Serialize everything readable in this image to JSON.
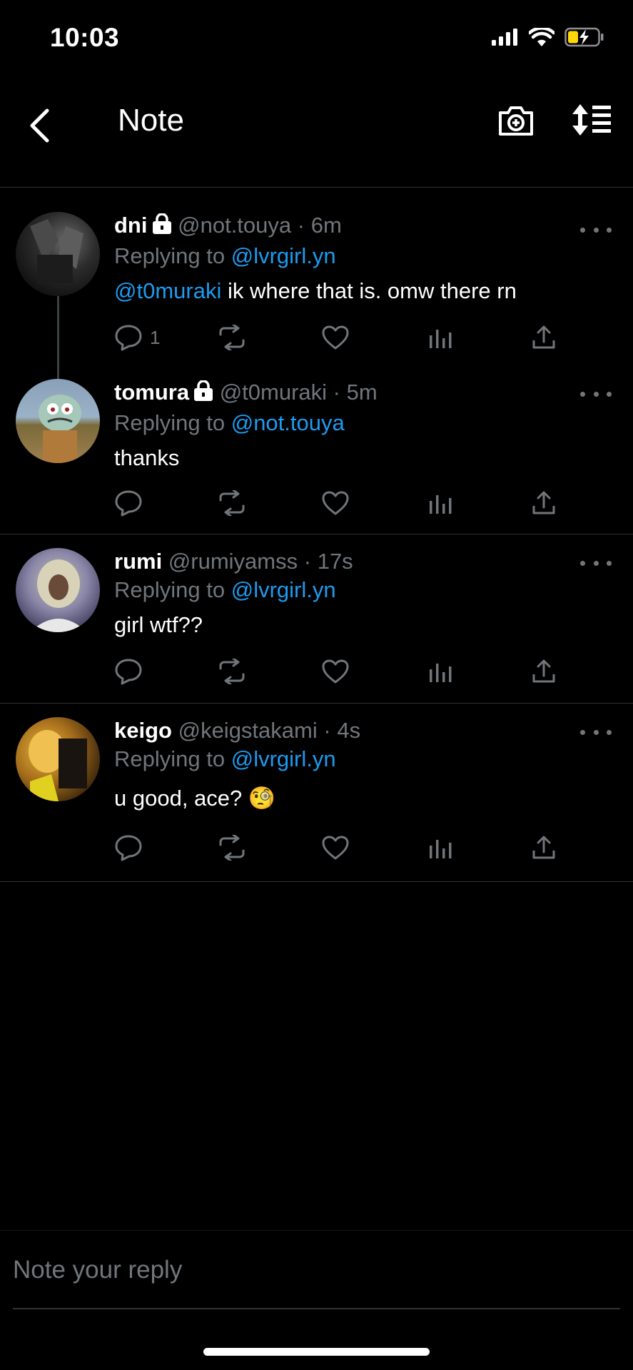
{
  "status_bar": {
    "time": "10:03"
  },
  "header": {
    "title": "Note"
  },
  "replies": [
    {
      "name": "dni",
      "handle": "@not.touya",
      "dot": "·",
      "time": "6m",
      "replying_prefix": "Replying to",
      "replying_to": "@lvrgirl.yn",
      "mention": "@t0muraki",
      "text": " ik where that is. omw there rn",
      "reply_count": "1",
      "locked": true
    },
    {
      "name": "tomura",
      "handle": "@t0muraki",
      "dot": "·",
      "time": "5m",
      "replying_prefix": "Replying to",
      "replying_to": "@not.touya",
      "text": "thanks",
      "reply_count": "",
      "locked": true
    },
    {
      "name": "rumi",
      "handle": "@rumiyamss",
      "dot": "·",
      "time": "17s",
      "replying_prefix": "Replying to",
      "replying_to": "@lvrgirl.yn",
      "text": "girl wtf??",
      "reply_count": "",
      "locked": false
    },
    {
      "name": "keigo",
      "handle": "@keigstakami",
      "dot": "·",
      "time": "4s",
      "replying_prefix": "Replying to",
      "replying_to": "@lvrgirl.yn",
      "text": "u good, ace? 🧐",
      "reply_count": "",
      "locked": false
    }
  ],
  "compose": {
    "placeholder": "Note your reply"
  },
  "colors": {
    "accent": "#1d9bf0",
    "muted": "#71767b",
    "divider": "#2f3336",
    "battery": "#ffd60a"
  },
  "icons": [
    "back-arrow-icon",
    "camera-plus-icon",
    "sort-icon",
    "lock-icon",
    "reply-icon",
    "retweet-icon",
    "like-icon",
    "views-icon",
    "share-icon",
    "more-icon"
  ]
}
